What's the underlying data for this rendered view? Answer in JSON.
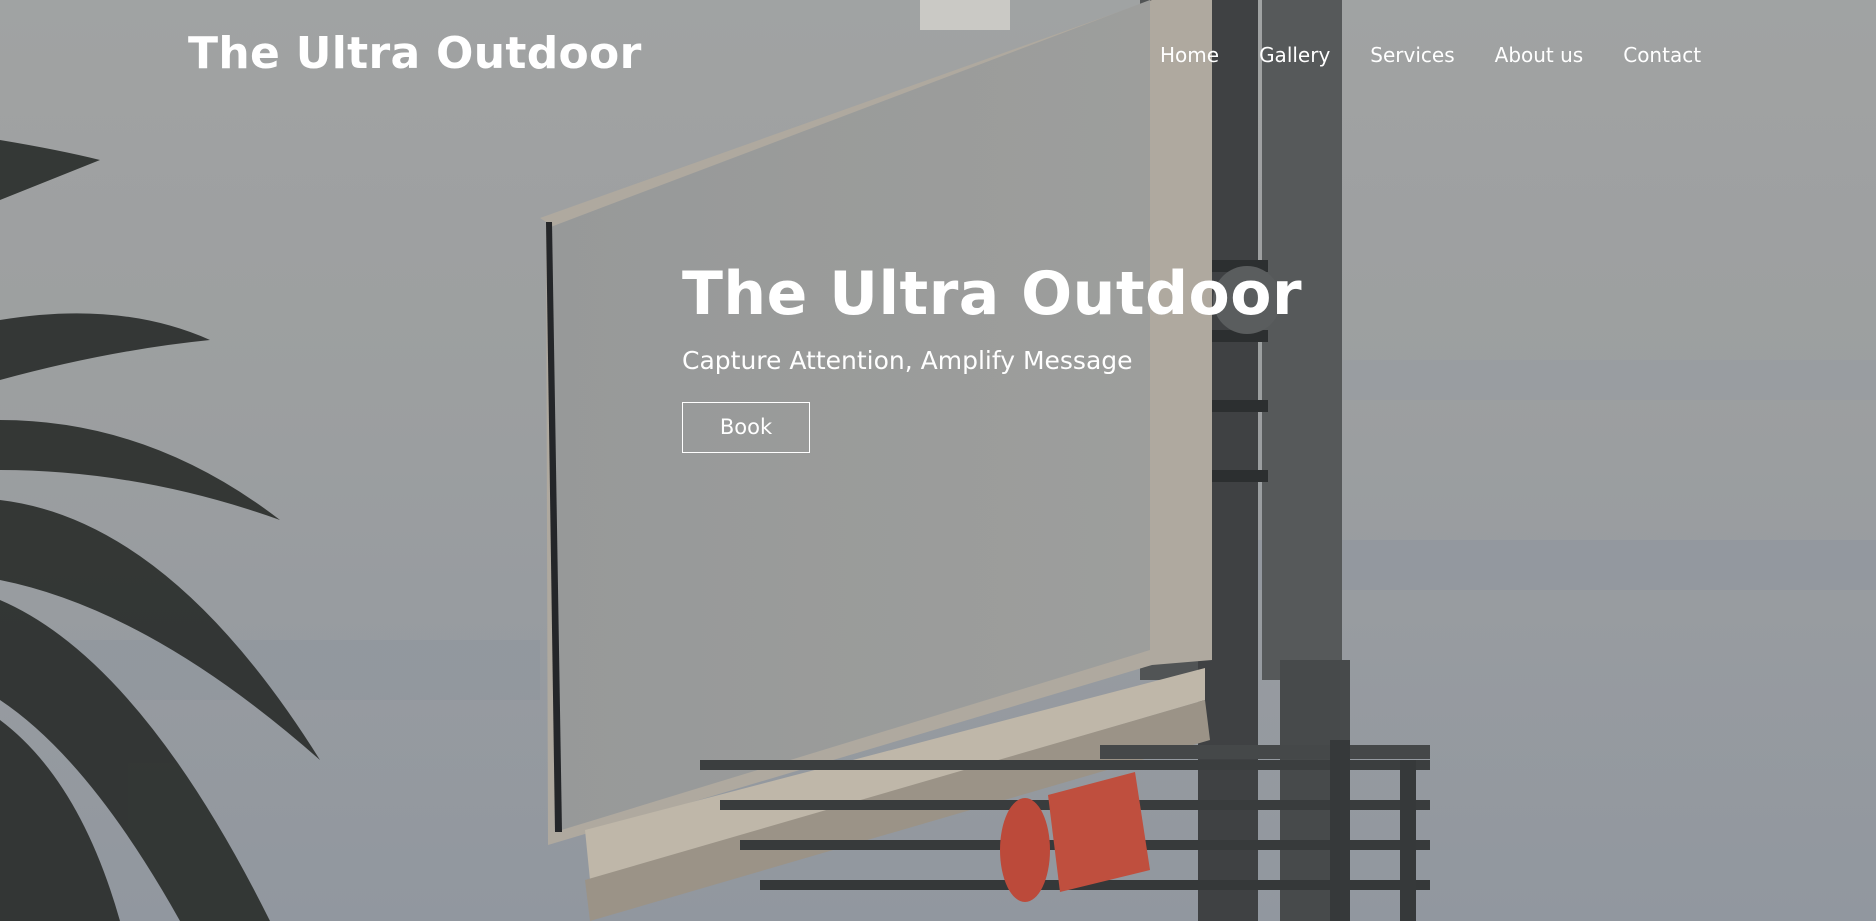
{
  "header": {
    "brand": "The Ultra Outdoor",
    "nav": [
      {
        "label": "Home"
      },
      {
        "label": "Gallery"
      },
      {
        "label": "Services"
      },
      {
        "label": "About us"
      },
      {
        "label": "Contact"
      }
    ]
  },
  "hero": {
    "title": "The Ultra Outdoor",
    "subtitle": "Capture Attention, Amplify Message",
    "button_label": "Book"
  },
  "colors": {
    "text": "#ffffff",
    "sky": "#a8abab",
    "billboard_panel": "#a4a6a5",
    "billboard_frame": "#bdb6aa",
    "steel": "#4e5152",
    "accent_sign": "#c9503f",
    "palm": "#2f3230"
  }
}
